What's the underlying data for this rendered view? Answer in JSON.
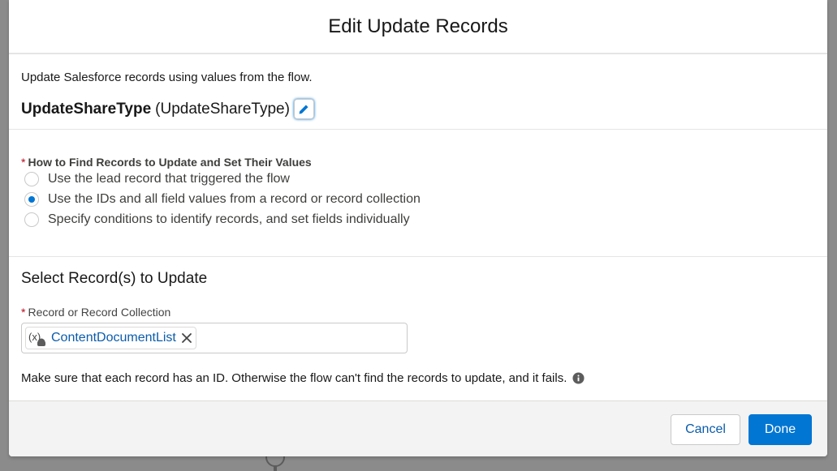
{
  "modal": {
    "title": "Edit Update Records"
  },
  "element": {
    "description": "Update Salesforce records using values from the flow.",
    "label": "UpdateShareType",
    "api_name": "(UpdateShareType)"
  },
  "how_to_find": {
    "required_marker": "*",
    "label": "How to Find Records to Update and Set Their Values",
    "options": [
      {
        "label": "Use the lead record that triggered the flow",
        "selected": false
      },
      {
        "label": "Use the IDs and all field values from a record or record collection",
        "selected": true
      },
      {
        "label": "Specify conditions to identify records, and set fields individually",
        "selected": false
      }
    ]
  },
  "select_records": {
    "title": "Select Record(s) to Update",
    "field_required_marker": "*",
    "field_label": "Record or Record Collection",
    "pill_value": "ContentDocumentList",
    "note": "Make sure that each record has an ID. Otherwise the flow can't find the records to update, and it fails."
  },
  "footer": {
    "cancel_label": "Cancel",
    "done_label": "Done"
  },
  "colors": {
    "brand": "#0176d3",
    "link": "#0b5cab",
    "required": "#ba0517"
  },
  "icons": {
    "edit": "pencil-icon",
    "pill_variable": "variable-icon",
    "remove": "close-icon",
    "info": "info-icon"
  }
}
